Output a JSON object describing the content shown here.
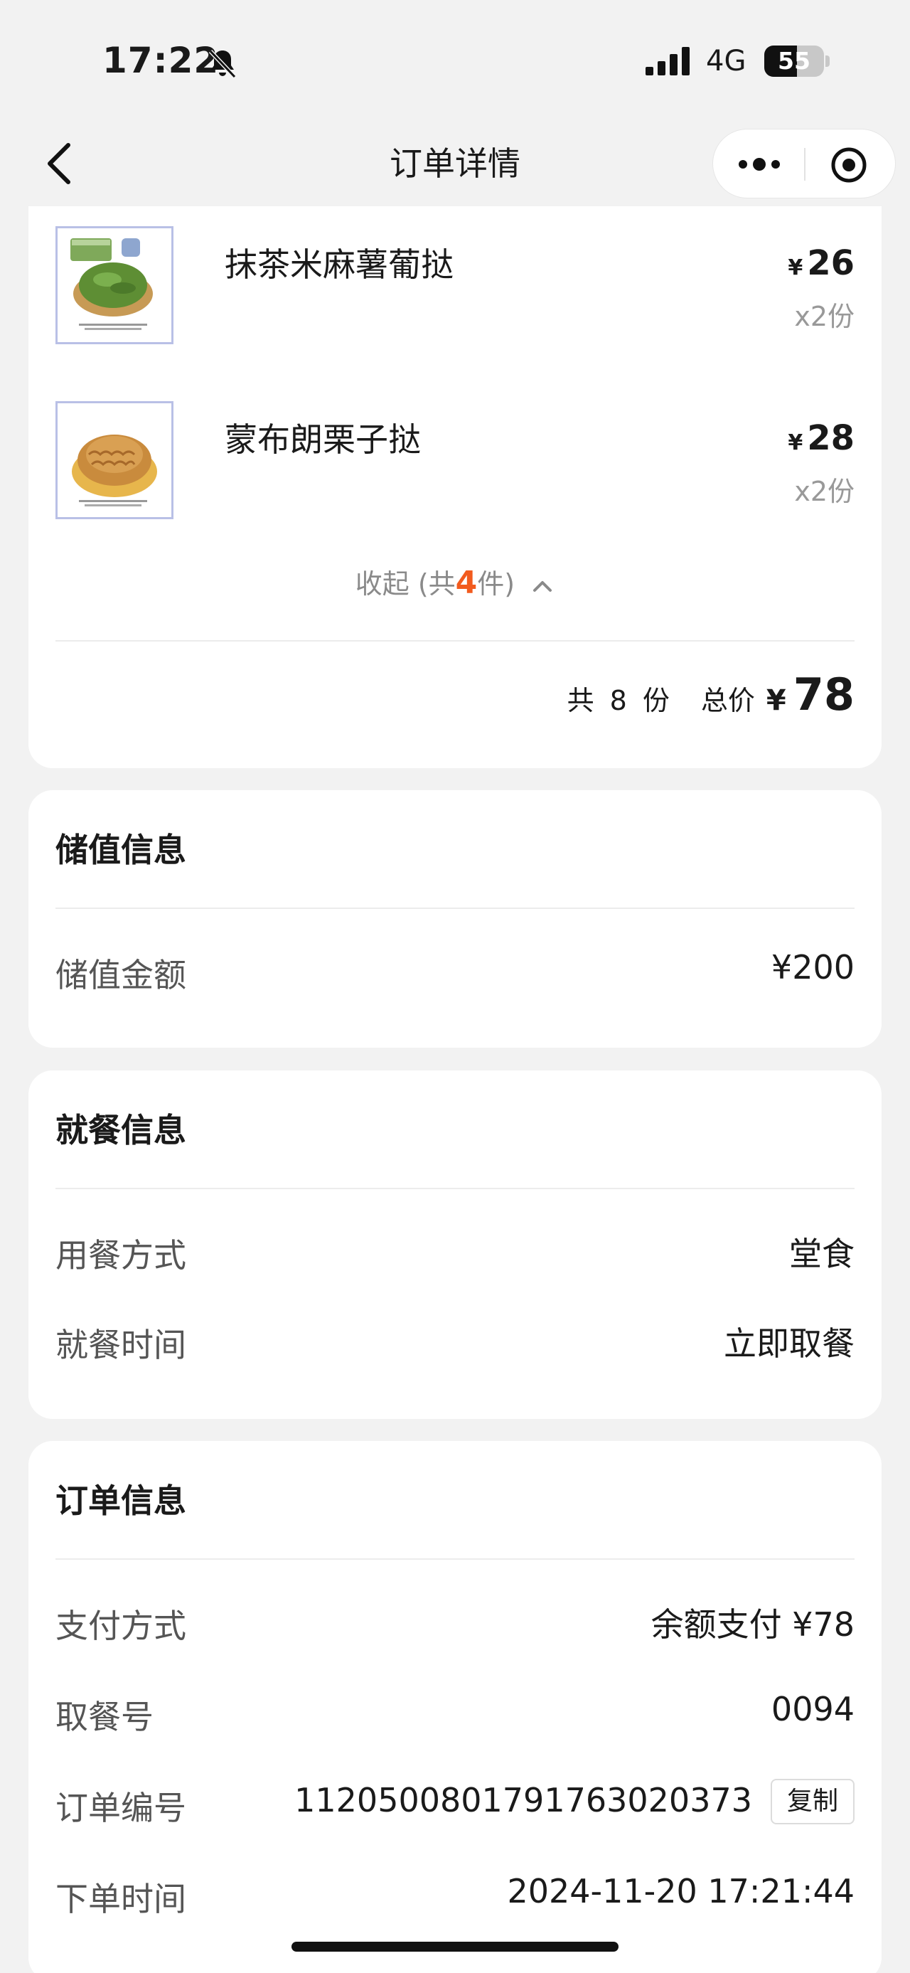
{
  "status_bar": {
    "time": "17:22",
    "network": "4G",
    "battery_level": "55",
    "battery_fraction": 0.55
  },
  "nav": {
    "title": "订单详情"
  },
  "items": [
    {
      "name": "抹茶米麻薯葡挞",
      "currency": "¥",
      "price": "26",
      "qty": "x2份"
    },
    {
      "name": "蒙布朗栗子挞",
      "currency": "¥",
      "price": "28",
      "qty": "x2份"
    }
  ],
  "collapse": {
    "prefix": "收起 (共",
    "count": "4",
    "suffix": "件)"
  },
  "summary": {
    "gong": "共",
    "count": "8",
    "unit": "份",
    "total_label": "总价",
    "currency": "¥",
    "total": "78"
  },
  "stored_value": {
    "title": "储值信息",
    "amount_label": "储值金额",
    "amount_value": "¥200"
  },
  "dining": {
    "title": "就餐信息",
    "mode_label": "用餐方式",
    "mode_value": "堂食",
    "time_label": "就餐时间",
    "time_value": "立即取餐"
  },
  "order": {
    "title": "订单信息",
    "pay_label": "支付方式",
    "pay_value": "余额支付 ¥78",
    "pickup_label": "取餐号",
    "pickup_value": "0094",
    "number_label": "订单编号",
    "number_value": "1120500801791763020373",
    "copy_label": "复制",
    "time_label": "下单时间",
    "time_value": "2024-11-20 17:21:44"
  },
  "colors": {
    "accent": "#f25b1e",
    "background": "#f2f2f2",
    "card": "#ffffff"
  }
}
